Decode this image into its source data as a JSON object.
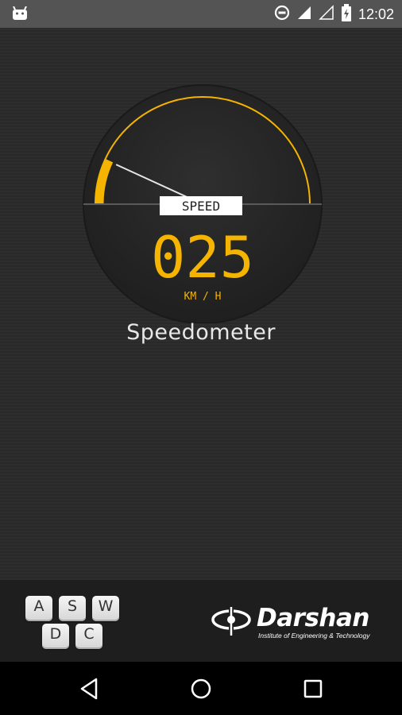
{
  "status_bar": {
    "time": "12:02",
    "icons": [
      "android-icon",
      "do-not-disturb-icon",
      "signal-icon",
      "no-signal-icon",
      "battery-charging-icon"
    ]
  },
  "speedometer": {
    "label": "SPEED",
    "value": "025",
    "unit": "KM / H",
    "speed_kmh": 25,
    "accent_color": "#F5B400"
  },
  "app": {
    "title": "Speedometer"
  },
  "footer": {
    "keys_row1": [
      "A",
      "S",
      "W"
    ],
    "keys_row2": [
      "D",
      "C"
    ],
    "brand_name": "Darshan",
    "brand_tagline": "Institute of Engineering & Technology"
  },
  "nav_bar": {
    "buttons": [
      "back-icon",
      "home-icon",
      "recents-icon"
    ]
  }
}
